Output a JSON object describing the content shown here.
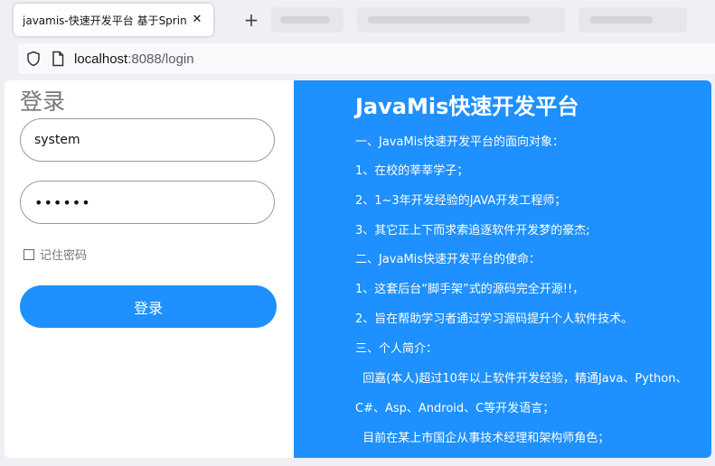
{
  "browser": {
    "active_tab_title": "javamis-快速开发平台 基于SpringB",
    "close_symbol": "✕",
    "new_tab_symbol": "+",
    "url_host": "localhost",
    "url_rest": ":8088/login"
  },
  "login": {
    "title": "登录",
    "username_value": "system",
    "password_mask": "••••••",
    "remember_label": "记住密码",
    "submit_label": "登录"
  },
  "info": {
    "title": "JavaMis快速开发平台",
    "lines": [
      "一、JavaMis快速开发平台的面向对象：",
      "1、在校的莘莘学子；",
      "2、1~3年开发经验的JAVA开发工程师；",
      "3、其它正上下而求索追逐软件开发梦的豪杰;",
      "二、JavaMis快速开发平台的使命：",
      "1、这套后台“脚手架”式的源码完全开源!!，",
      "2、旨在帮助学习者通过学习源码提升个人软件技术。",
      "三、个人简介：",
      "  回嘉(本人)超过10年以上软件开发经验，精通Java、Python、",
      "C#、Asp、Android、C等开发语言；",
      "  目前在某上市国企从事技术经理和架构师角色；"
    ]
  },
  "colors": {
    "accent": "#1e90ff"
  }
}
